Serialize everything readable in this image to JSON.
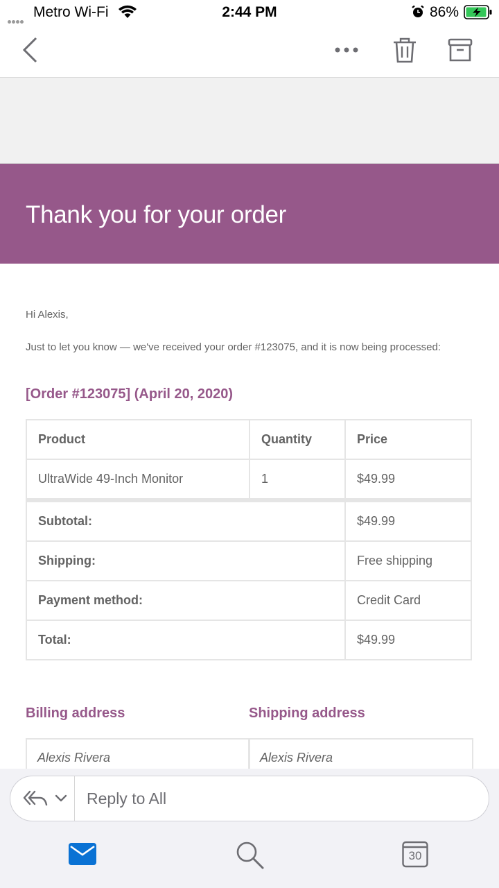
{
  "status_bar": {
    "carrier": "Metro Wi-Fi",
    "time": "2:44 PM",
    "battery_percent": "86%"
  },
  "nav_bar": {
    "icons": [
      "back-chevron-icon",
      "more-icon",
      "trash-icon",
      "archive-icon"
    ]
  },
  "email": {
    "banner_title": "Thank you for your order",
    "banner_color": "#96588a",
    "greeting": "Hi Alexis,",
    "intro": "Just to let you know — we've received your order #123075, and it is now being processed:",
    "order_heading": "[Order #123075] (April 20, 2020)",
    "table": {
      "headers": [
        "Product",
        "Quantity",
        "Price"
      ],
      "items": [
        {
          "product": "UltraWide 49-Inch Monitor",
          "quantity": "1",
          "price": "$49.99"
        }
      ],
      "totals": [
        {
          "label": "Subtotal:",
          "value": "$49.99"
        },
        {
          "label": "Shipping:",
          "value": "Free shipping"
        },
        {
          "label": "Payment method:",
          "value": "Credit Card"
        },
        {
          "label": "Total:",
          "value": "$49.99"
        }
      ]
    },
    "billing": {
      "heading": "Billing address",
      "name": "Alexis Rivera"
    },
    "shipping": {
      "heading": "Shipping address",
      "name": "Alexis Rivera"
    }
  },
  "reply_bar": {
    "placeholder": "Reply to All"
  },
  "tab_bar": {
    "calendar_day": "30",
    "accent_color": "#0a72d4"
  }
}
